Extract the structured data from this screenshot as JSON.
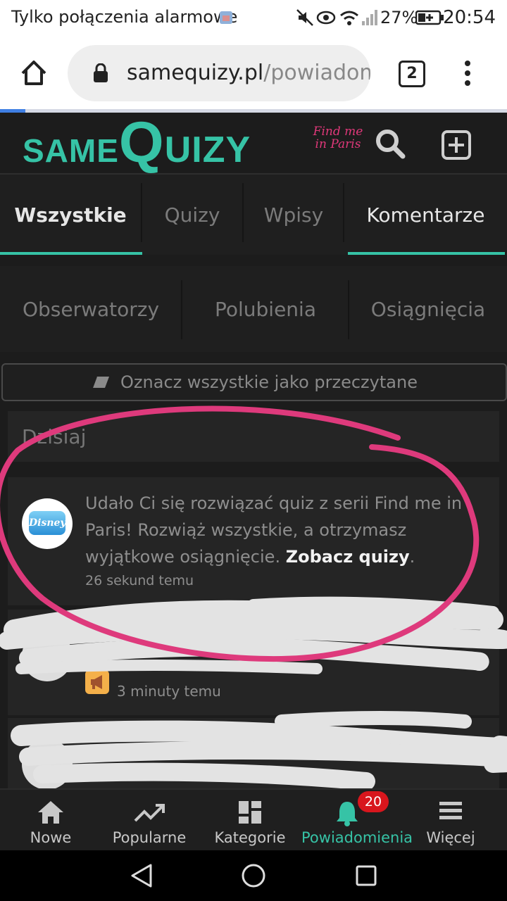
{
  "status_bar": {
    "carrier": "Tylko połączenia alarmowe",
    "battery": "27%",
    "time": "20:54"
  },
  "browser": {
    "url_domain": "samequizy.pl",
    "url_path": "/powiadom",
    "tab_count": "2"
  },
  "site": {
    "logo_same": "SAME",
    "logo_q": "Q",
    "logo_uizy": "UIZY",
    "promo": "Find me in Paris",
    "accent_color": "#36c3a6"
  },
  "tabs_primary": [
    "Wszystkie",
    "Quizy",
    "Wpisy",
    "Komentarze"
  ],
  "tabs_secondary": [
    "Obserwatorzy",
    "Polubienia",
    "Osiągnięcia"
  ],
  "mark_all_label": "Oznacz wszystkie jako przeczytane",
  "section_label": "Dzisiaj",
  "notifications": [
    {
      "text": "Udało Ci się rozwiązać quiz z serii Find me in Paris! Rozwiąż wszystkie, a otrzymasz wyjątkowe osiągnięcie.",
      "link": "Zobacz quizy",
      "time": "26 sekund temu",
      "avatar_label": "Disney"
    },
    {
      "time": "3 minuty temu"
    }
  ],
  "bottom_nav": [
    {
      "label": "Nowe",
      "icon": "home-icon"
    },
    {
      "label": "Popularne",
      "icon": "trending-icon"
    },
    {
      "label": "Kategorie",
      "icon": "dashboard-icon"
    },
    {
      "label": "Powiadomienia",
      "icon": "bell-icon",
      "badge": "20",
      "active": true
    },
    {
      "label": "Więcej",
      "icon": "menu-icon"
    }
  ]
}
